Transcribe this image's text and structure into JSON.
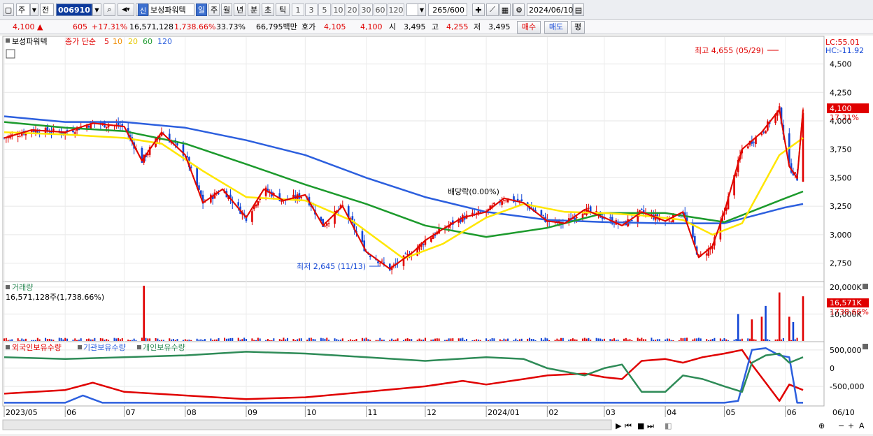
{
  "toolbar": {
    "type_select": "주",
    "mode_label": "전",
    "code": "006910",
    "shin_badge": "신",
    "stock_name": "보성파워텍",
    "period_tabs": [
      "일",
      "주",
      "월",
      "년",
      "분",
      "초",
      "틱"
    ],
    "active_period": "일",
    "num_buttons": [
      "1",
      "3",
      "5",
      "10",
      "20",
      "30",
      "60",
      "120"
    ],
    "count": "265",
    "count_total": "/600",
    "date": "2024/06/10"
  },
  "quote": {
    "price": "4,100",
    "arrow": "▲",
    "change": "605",
    "change_pct": "+17.31%",
    "volume": "16,571,128",
    "volume_pct": "1,738.66%",
    "turnover": "33.73%",
    "amount": "66,795백만",
    "hoga_label": "호가",
    "hoga1": "4,105",
    "hoga2": "4,100",
    "open_label": "시",
    "open": "3,495",
    "high_label": "고",
    "high": "4,255",
    "low_label": "저",
    "low": "3,495",
    "buy_label": "매수",
    "sell_label": "매도",
    "avg_label": "평"
  },
  "price_panel": {
    "name": "보성파워텍",
    "legend_title": "종가 단순",
    "ma_periods": [
      "5",
      "10",
      "20",
      "60",
      "120"
    ],
    "lc": "LC:55.01",
    "hc": "HC:-11.92",
    "current_price_tag": "4,100",
    "current_pct_tag": "17.31%",
    "high_annotation": "최고 4,655 (05/29)",
    "low_annotation": "최저 2,645 (11/13)",
    "dividend_annotation": "배당락(0.00%)"
  },
  "volume_panel": {
    "title": "거래량",
    "value": "16,571,128주(1,738.66%)",
    "tag_value": "16,571K",
    "tag_pct": "1738.66%"
  },
  "holdings_panel": {
    "legend": [
      "외국인보유수량",
      "기관보유수량",
      "개인보유수량"
    ]
  },
  "colors": {
    "up": "#e00000",
    "down": "#1145d6",
    "ma5": "#e00000",
    "ma10": "#f08c00",
    "ma20": "#ffe600",
    "ma60": "#1c9a2c",
    "ma120": "#2c5fde",
    "foreign": "#e00000",
    "institution": "#2c5fde",
    "individual": "#2e8b57"
  },
  "chart_data": [
    {
      "type": "candlestick",
      "title": "보성파워텍",
      "x_labels": [
        "2023/05",
        "06",
        "07",
        "08",
        "09",
        "10",
        "11",
        "12",
        "2024/01",
        "02",
        "03",
        "04",
        "05",
        "06",
        "06/10"
      ],
      "ylim": [
        2600,
        4700
      ],
      "y_ticks": [
        "2,750",
        "3,000",
        "3,250",
        "3,500",
        "3,750",
        "4,000",
        "4,250",
        "4,500"
      ],
      "close_path": [
        [
          "2023-05-01",
          3850
        ],
        [
          "2023-05-15",
          3920
        ],
        [
          "2023-06-01",
          3900
        ],
        [
          "2023-06-15",
          3980
        ],
        [
          "2023-07-01",
          3950
        ],
        [
          "2023-07-10",
          3650
        ],
        [
          "2023-07-20",
          3900
        ],
        [
          "2023-08-01",
          3700
        ],
        [
          "2023-08-10",
          3280
        ],
        [
          "2023-08-20",
          3400
        ],
        [
          "2023-09-01",
          3150
        ],
        [
          "2023-09-10",
          3400
        ],
        [
          "2023-09-20",
          3300
        ],
        [
          "2023-10-01",
          3350
        ],
        [
          "2023-10-10",
          3080
        ],
        [
          "2023-10-20",
          3250
        ],
        [
          "2023-11-01",
          2850
        ],
        [
          "2023-11-13",
          2700
        ],
        [
          "2023-11-25",
          2850
        ],
        [
          "2023-12-01",
          2950
        ],
        [
          "2023-12-10",
          3050
        ],
        [
          "2023-12-20",
          3150
        ],
        [
          "2024-01-01",
          3200
        ],
        [
          "2024-01-10",
          3320
        ],
        [
          "2024-01-20",
          3280
        ],
        [
          "2024-02-01",
          3120
        ],
        [
          "2024-02-10",
          3100
        ],
        [
          "2024-02-20",
          3220
        ],
        [
          "2024-03-01",
          3150
        ],
        [
          "2024-03-10",
          3080
        ],
        [
          "2024-03-20",
          3200
        ],
        [
          "2024-04-01",
          3120
        ],
        [
          "2024-04-10",
          3200
        ],
        [
          "2024-04-18",
          2800
        ],
        [
          "2024-04-25",
          2900
        ],
        [
          "2024-05-01",
          3200
        ],
        [
          "2024-05-10",
          3750
        ],
        [
          "2024-05-20",
          3900
        ],
        [
          "2024-05-29",
          4100
        ],
        [
          "2024-06-03",
          3600
        ],
        [
          "2024-06-07",
          3495
        ],
        [
          "2024-06-10",
          4100
        ]
      ],
      "ma20_path": [
        [
          "2023-05-01",
          3900
        ],
        [
          "2023-06-01",
          3880
        ],
        [
          "2023-07-01",
          3850
        ],
        [
          "2023-07-20",
          3800
        ],
        [
          "2023-08-10",
          3560
        ],
        [
          "2023-09-01",
          3330
        ],
        [
          "2023-10-01",
          3300
        ],
        [
          "2023-10-25",
          3120
        ],
        [
          "2023-11-20",
          2790
        ],
        [
          "2023-12-10",
          2920
        ],
        [
          "2024-01-01",
          3150
        ],
        [
          "2024-01-20",
          3270
        ],
        [
          "2024-02-10",
          3200
        ],
        [
          "2024-03-01",
          3190
        ],
        [
          "2024-03-20",
          3170
        ],
        [
          "2024-04-10",
          3130
        ],
        [
          "2024-04-25",
          3000
        ],
        [
          "2024-05-10",
          3100
        ],
        [
          "2024-05-29",
          3700
        ],
        [
          "2024-06-10",
          3850
        ]
      ],
      "ma60_path": [
        [
          "2023-05-01",
          3990
        ],
        [
          "2023-06-01",
          3940
        ],
        [
          "2023-07-01",
          3910
        ],
        [
          "2023-08-01",
          3800
        ],
        [
          "2023-09-01",
          3620
        ],
        [
          "2023-10-01",
          3440
        ],
        [
          "2023-11-01",
          3270
        ],
        [
          "2023-12-01",
          3080
        ],
        [
          "2024-01-01",
          2980
        ],
        [
          "2024-02-01",
          3060
        ],
        [
          "2024-03-01",
          3190
        ],
        [
          "2024-04-01",
          3190
        ],
        [
          "2024-05-01",
          3110
        ],
        [
          "2024-06-01",
          3320
        ],
        [
          "2024-06-10",
          3380
        ]
      ],
      "ma120_path": [
        [
          "2023-05-01",
          4040
        ],
        [
          "2023-06-01",
          3990
        ],
        [
          "2023-07-01",
          3990
        ],
        [
          "2023-08-01",
          3940
        ],
        [
          "2023-09-01",
          3830
        ],
        [
          "2023-10-01",
          3700
        ],
        [
          "2023-11-01",
          3500
        ],
        [
          "2023-12-01",
          3330
        ],
        [
          "2024-01-01",
          3200
        ],
        [
          "2024-02-01",
          3130
        ],
        [
          "2024-03-01",
          3110
        ],
        [
          "2024-04-01",
          3100
        ],
        [
          "2024-05-01",
          3100
        ],
        [
          "2024-06-01",
          3240
        ],
        [
          "2024-06-10",
          3270
        ]
      ],
      "high": {
        "date": "2024-05-29",
        "value": 4655
      },
      "low": {
        "date": "2023-11-13",
        "value": 2645
      }
    },
    {
      "type": "bar",
      "title": "거래량",
      "ylim": [
        0,
        21000000
      ],
      "y_ticks": [
        "10,000K",
        "20,000K"
      ],
      "spikes": [
        [
          "2023-07-11",
          20500000
        ],
        [
          "2024-05-08",
          10000000
        ],
        [
          "2024-05-15",
          8000000
        ],
        [
          "2024-05-20",
          9000000
        ],
        [
          "2024-05-22",
          13000000
        ],
        [
          "2024-05-29",
          18000000
        ],
        [
          "2024-06-03",
          9000000
        ],
        [
          "2024-06-05",
          7000000
        ],
        [
          "2024-06-10",
          16571128
        ]
      ],
      "base_volume": 800000
    },
    {
      "type": "line",
      "title": "보유수량",
      "ylim": [
        -1000000,
        650000
      ],
      "y_ticks": [
        "500,000",
        "0",
        "-500,000"
      ],
      "series": [
        {
          "name": "외국인보유수량",
          "points": [
            [
              "2023-05-01",
              -700000
            ],
            [
              "2023-06-01",
              -600000
            ],
            [
              "2023-06-15",
              -400000
            ],
            [
              "2023-07-01",
              -650000
            ],
            [
              "2023-08-01",
              -750000
            ],
            [
              "2023-09-01",
              -850000
            ],
            [
              "2023-10-01",
              -800000
            ],
            [
              "2023-11-01",
              -650000
            ],
            [
              "2023-12-01",
              -500000
            ],
            [
              "2023-12-20",
              -350000
            ],
            [
              "2024-01-01",
              -450000
            ],
            [
              "2024-01-20",
              -300000
            ],
            [
              "2024-02-01",
              -200000
            ],
            [
              "2024-02-20",
              -150000
            ],
            [
              "2024-03-01",
              -250000
            ],
            [
              "2024-03-10",
              -300000
            ],
            [
              "2024-03-20",
              200000
            ],
            [
              "2024-04-01",
              250000
            ],
            [
              "2024-04-10",
              150000
            ],
            [
              "2024-04-20",
              300000
            ],
            [
              "2024-05-01",
              400000
            ],
            [
              "2024-05-10",
              500000
            ],
            [
              "2024-05-15",
              100000
            ],
            [
              "2024-05-22",
              -400000
            ],
            [
              "2024-05-29",
              -900000
            ],
            [
              "2024-06-03",
              -450000
            ],
            [
              "2024-06-10",
              -600000
            ]
          ]
        },
        {
          "name": "기관보유수량",
          "points": [
            [
              "2023-05-01",
              -950000
            ],
            [
              "2023-06-01",
              -950000
            ],
            [
              "2023-06-10",
              -750000
            ],
            [
              "2023-06-20",
              -950000
            ],
            [
              "2023-12-20",
              -950000
            ],
            [
              "2024-05-01",
              -950000
            ],
            [
              "2024-05-08",
              -900000
            ],
            [
              "2024-05-15",
              500000
            ],
            [
              "2024-05-22",
              550000
            ],
            [
              "2024-05-29",
              350000
            ],
            [
              "2024-06-03",
              300000
            ],
            [
              "2024-06-07",
              -950000
            ],
            [
              "2024-06-10",
              -950000
            ]
          ]
        },
        {
          "name": "개인보유수량",
          "points": [
            [
              "2023-05-01",
              300000
            ],
            [
              "2023-06-01",
              250000
            ],
            [
              "2023-07-01",
              300000
            ],
            [
              "2023-08-01",
              350000
            ],
            [
              "2023-09-01",
              450000
            ],
            [
              "2023-10-01",
              400000
            ],
            [
              "2023-11-01",
              300000
            ],
            [
              "2023-12-01",
              200000
            ],
            [
              "2024-01-01",
              300000
            ],
            [
              "2024-01-20",
              250000
            ],
            [
              "2024-02-01",
              0
            ],
            [
              "2024-02-20",
              -200000
            ],
            [
              "2024-03-01",
              0
            ],
            [
              "2024-03-10",
              100000
            ],
            [
              "2024-03-20",
              -650000
            ],
            [
              "2024-04-01",
              -650000
            ],
            [
              "2024-04-10",
              -200000
            ],
            [
              "2024-04-20",
              -300000
            ],
            [
              "2024-05-01",
              -500000
            ],
            [
              "2024-05-10",
              -650000
            ],
            [
              "2024-05-15",
              150000
            ],
            [
              "2024-05-22",
              350000
            ],
            [
              "2024-05-29",
              400000
            ],
            [
              "2024-06-03",
              150000
            ],
            [
              "2024-06-10",
              300000
            ]
          ]
        }
      ]
    }
  ]
}
